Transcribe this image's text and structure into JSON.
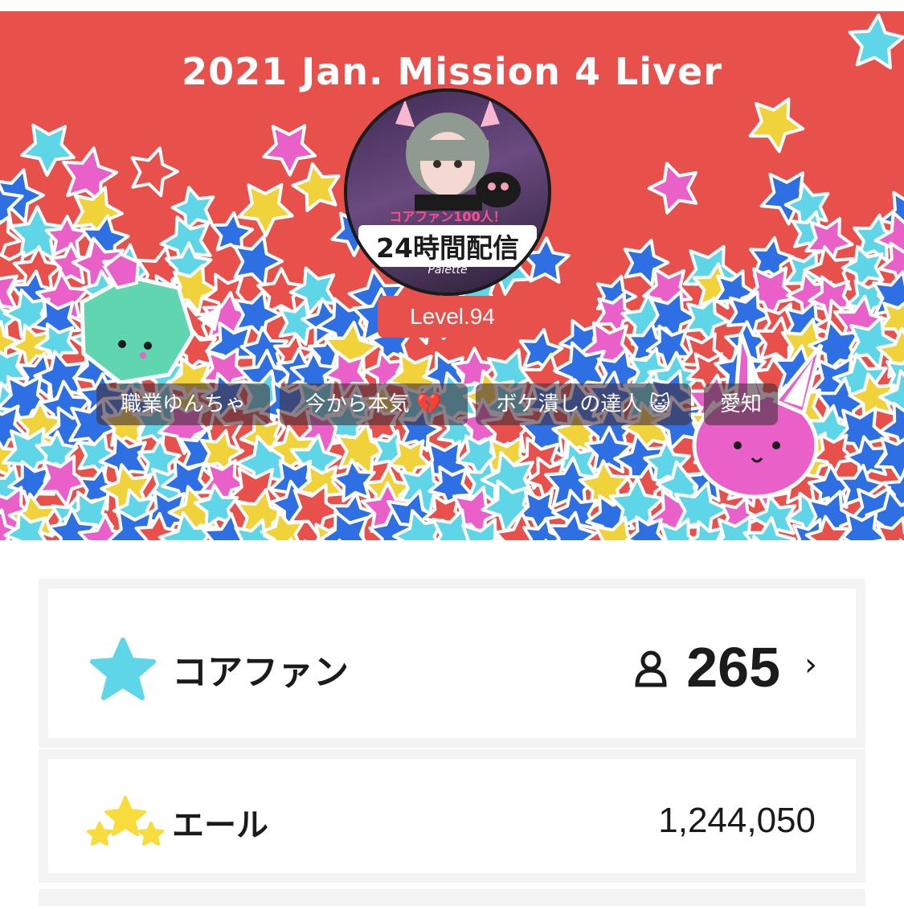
{
  "banner": {
    "title": "2021 Jan. Mission 4 Liver",
    "background_color": "#e8504b",
    "avatar": {
      "caption_small": "コアファン100人！",
      "caption_big": "24時間配信",
      "caption_brand": "Palette"
    },
    "level_label": "Level.94",
    "tags": [
      {
        "label": "職業ゆんちゃ"
      },
      {
        "label": "今から本気 💔"
      },
      {
        "label": "ボケ潰しの達人 😺"
      },
      {
        "label": "愛知"
      }
    ]
  },
  "stats": {
    "core_fans": {
      "label": "コアファン",
      "icon": "star-icon",
      "person_icon": "person-icon",
      "count": "265",
      "chevron": "›",
      "icon_color": "#5fd6e8"
    },
    "yell": {
      "label": "エール",
      "icon": "three-stars-icon",
      "value": "1,244,050",
      "icon_color": "#f7dc3c"
    }
  }
}
